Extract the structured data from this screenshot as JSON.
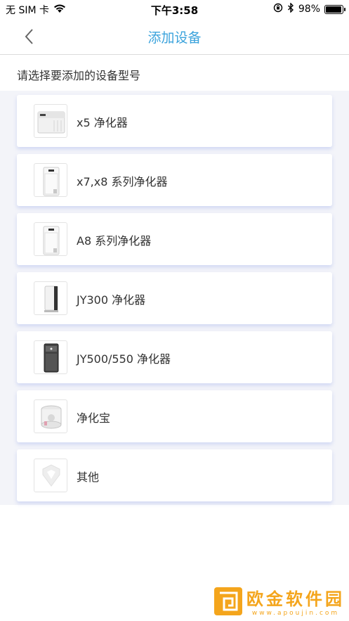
{
  "status_bar": {
    "carrier": "无 SIM 卡",
    "time": "下午3:58",
    "battery_percent": "98%",
    "battery_level": 0.98,
    "icons": [
      "wifi-icon",
      "orientation-lock-icon",
      "bluetooth-icon",
      "battery-icon"
    ]
  },
  "nav": {
    "title": "添加设备",
    "back_icon": "chevron-left-icon",
    "accent_color": "#3ba3dc"
  },
  "subtitle": "请选择要添加的设备型号",
  "devices": [
    {
      "label": "x5 净化器",
      "icon": "purifier-x5-image"
    },
    {
      "label": "x7,x8 系列净化器",
      "icon": "purifier-x7-image"
    },
    {
      "label": "A8 系列净化器",
      "icon": "purifier-a8-image"
    },
    {
      "label": "JY300 净化器",
      "icon": "purifier-jy300-image"
    },
    {
      "label": "JY500/550 净化器",
      "icon": "purifier-jy500-image"
    },
    {
      "label": "净化宝",
      "icon": "purifier-cylinder-image"
    },
    {
      "label": "其他",
      "icon": "other-device-image"
    }
  ],
  "watermark": {
    "text": "欧金软件园",
    "url": "www.apoujin.com",
    "color": "#f4a51c"
  }
}
